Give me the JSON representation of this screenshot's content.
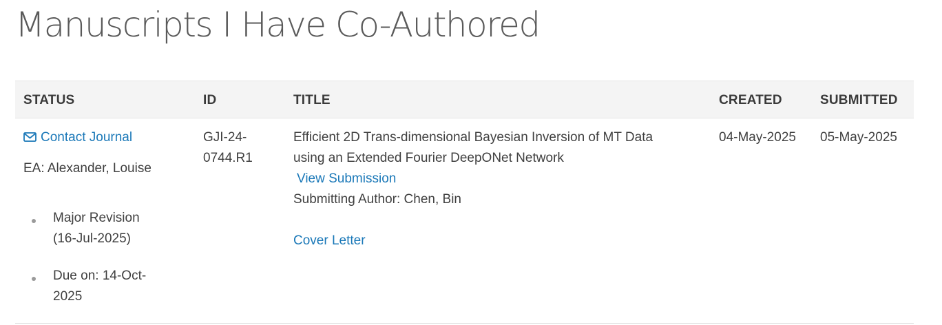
{
  "page": {
    "title": "Manuscripts I Have Co-Authored"
  },
  "table": {
    "headers": {
      "status": "STATUS",
      "id": "ID",
      "title": "TITLE",
      "created": "CREATED",
      "submitted": "SUBMITTED"
    },
    "rows": [
      {
        "status": {
          "contact_label": "Contact Journal",
          "contact_icon": "envelope-icon",
          "editor": "EA: Alexander, Louise",
          "items": [
            {
              "line1": "Major Revision",
              "line2": "(16-Jul-2025)"
            },
            {
              "line1": "Due on: 14-Oct-",
              "line2": "2025"
            }
          ]
        },
        "id": {
          "line1": "GJI-24-",
          "line2": "0744.R1"
        },
        "title": {
          "line1": "Efficient 2D Trans-dimensional Bayesian Inversion of MT Data",
          "line2": "using an Extended Fourier DeepONet Network",
          "view_link": "View Submission",
          "submitting_author": "Submitting Author: Chen, Bin",
          "cover_letter": "Cover Letter"
        },
        "created": "04-May-2025",
        "submitted": "05-May-2025"
      }
    ]
  },
  "colors": {
    "link": "#1a78b8",
    "header_bg": "#f4f4f4",
    "text": "#404040",
    "title": "#5a5a5a"
  }
}
